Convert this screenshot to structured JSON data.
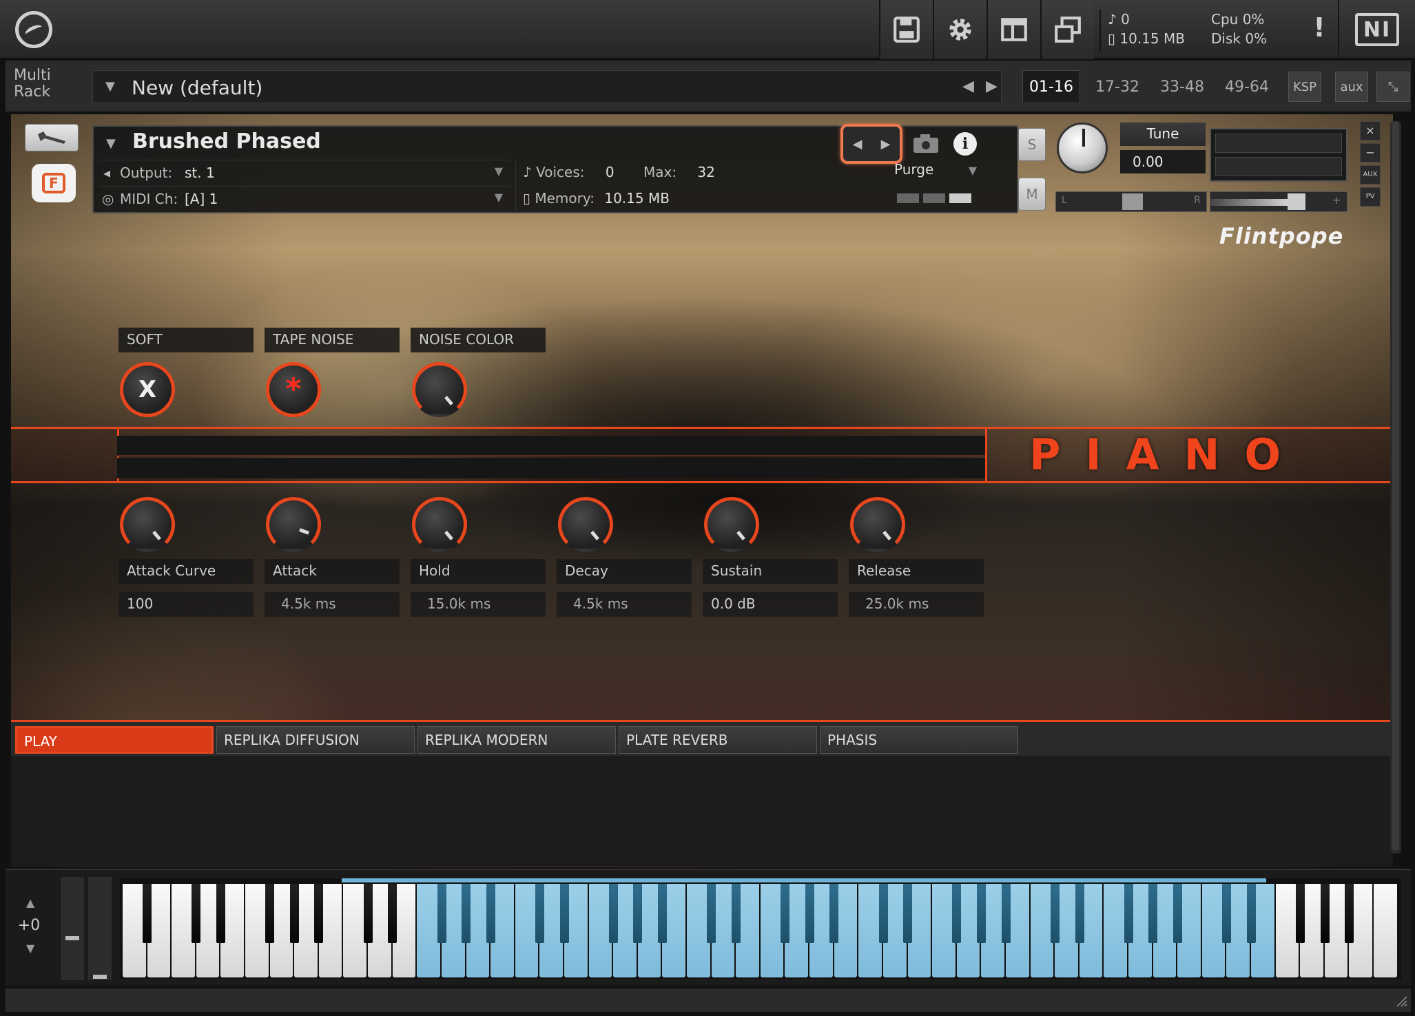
{
  "toolbar": {
    "buttons": [
      "save-icon",
      "gear-icon",
      "layout-icon",
      "window-icon"
    ],
    "voices_count": "0",
    "memory_total": "10.15 MB",
    "cpu_label": "Cpu",
    "cpu_value": "0%",
    "disk_label": "Disk",
    "disk_value": "0%",
    "warning": "!",
    "ni_logo": "NI"
  },
  "rack": {
    "mode_line1": "Multi",
    "mode_line2": "Rack",
    "preset_name": "New (default)",
    "pages": [
      "01-16",
      "17-32",
      "33-48",
      "49-64"
    ],
    "active_page": "01-16",
    "ksp_label": "KSP",
    "aux_label": "aux"
  },
  "instrument": {
    "name": "Brushed Phased",
    "output_label": "Output:",
    "output_value": "st. 1",
    "midi_label": "MIDI Ch:",
    "midi_value": "[A]  1",
    "voices_label": "Voices:",
    "voices_value": "0",
    "max_label": "Max:",
    "max_value": "32",
    "memory_label": "Memory:",
    "memory_value": "10.15 MB",
    "purge_label": "Purge",
    "solo_label": "S",
    "mute_label": "M",
    "tune_label": "Tune",
    "tune_value": "0.00",
    "pan_left": "L",
    "pan_right": "R",
    "vol_minus": "−",
    "vol_plus": "+",
    "side": {
      "close": "×",
      "min": "−",
      "aux": "AUX",
      "pv": "PV"
    }
  },
  "brand": "Flintpope",
  "title": "PIANO",
  "top_controls": [
    {
      "label": "SOFT",
      "glyph": "X"
    },
    {
      "label": "TAPE NOISE",
      "glyph": "*"
    },
    {
      "label": "NOISE COLOR",
      "glyph": ""
    }
  ],
  "envelope": [
    {
      "label": "Attack Curve",
      "value": "100"
    },
    {
      "label": "Attack",
      "value": "4.5k ms"
    },
    {
      "label": "Hold",
      "value": "15.0k ms"
    },
    {
      "label": "Decay",
      "value": "4.5k ms"
    },
    {
      "label": "Sustain",
      "value": "0.0 dB"
    },
    {
      "label": "Release",
      "value": "25.0k ms"
    }
  ],
  "tabs": [
    {
      "label": "PLAY",
      "active": true
    },
    {
      "label": "REPLIKA DIFFUSION",
      "active": false
    },
    {
      "label": "REPLIKA MODERN",
      "active": false
    },
    {
      "label": "PLATE REVERB",
      "active": false
    },
    {
      "label": "PHASIS",
      "active": false
    }
  ],
  "keyboard": {
    "octave_offset": "+0",
    "white_key_count": 52,
    "highlight_start_white": 12,
    "highlight_end_white": 47
  },
  "colors": {
    "accent": "#e8471d",
    "highlight_keys": "#8fc6e2",
    "nav_box": "#f07a50"
  }
}
